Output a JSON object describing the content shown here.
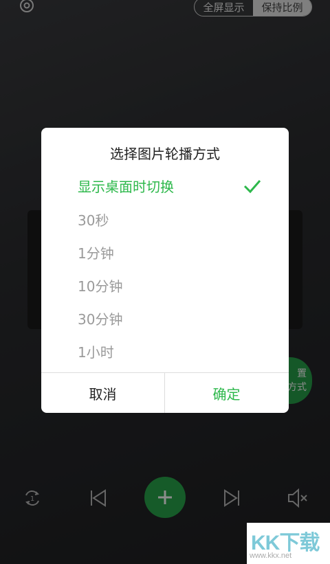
{
  "top": {
    "toggle": [
      "全屏显示",
      "保持比例"
    ]
  },
  "fab_partial": {
    "line1": "置",
    "line2": "方式"
  },
  "dialog": {
    "title": "选择图片轮播方式",
    "options": [
      "显示桌面时切换",
      "30秒",
      "1分钟",
      "10分钟",
      "30分钟",
      "1小时"
    ],
    "selected_index": 0,
    "cancel": "取消",
    "confirm": "确定"
  },
  "colors": {
    "accent": "#2db84b"
  },
  "watermark": {
    "logo": "KK下载",
    "url": "www.kkx.net"
  }
}
